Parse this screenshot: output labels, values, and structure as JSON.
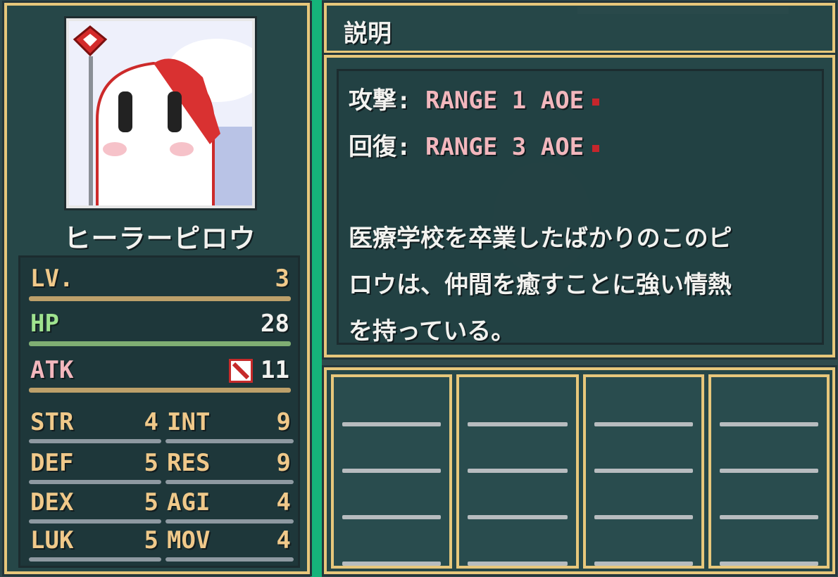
{
  "unit": {
    "name": "ヒーラーピロウ",
    "portrait": "healer-pillow-portrait"
  },
  "stats": {
    "lv": {
      "label": "LV.",
      "value": "3",
      "color": "#bda06a"
    },
    "hp": {
      "label": "HP",
      "value": "28",
      "color": "#7fae73"
    },
    "atk": {
      "label": "ATK",
      "value": "11",
      "color": "#bda06a",
      "icon": "staff-weapon-icon"
    },
    "grid": [
      {
        "key": "STR",
        "value": "4"
      },
      {
        "key": "INT",
        "value": "9"
      },
      {
        "key": "DEF",
        "value": "5"
      },
      {
        "key": "RES",
        "value": "9"
      },
      {
        "key": "DEX",
        "value": "5"
      },
      {
        "key": "AGI",
        "value": "4"
      },
      {
        "key": "LUK",
        "value": "5"
      },
      {
        "key": "MOV",
        "value": "4"
      }
    ]
  },
  "description": {
    "title": "説明",
    "attack_label": "攻撃:",
    "attack_value": "RANGE 1 AOE",
    "heal_label": "回復:",
    "heal_value": "RANGE 3 AOE",
    "text_lines": [
      "医療学校を卒業したばかりのこのピ",
      "ロウは、仲間を癒すことに強い情熱",
      "を持っている。"
    ]
  },
  "colors": {
    "frame": "#e7c77b",
    "accent_green": "#15b47a",
    "pink_text": "#f2b7bd",
    "stat_text": "#f0c98a"
  }
}
